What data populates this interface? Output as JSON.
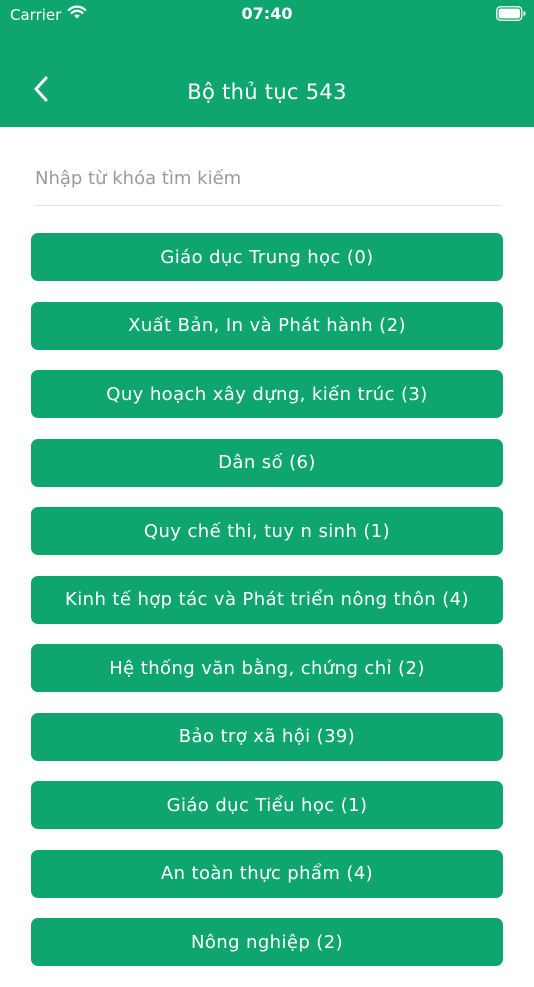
{
  "status_bar": {
    "carrier": "Carrier",
    "time": "07:40"
  },
  "nav": {
    "title": "Bộ thủ tục 543"
  },
  "search": {
    "value": "",
    "placeholder": "Nhập từ khóa tìm kiếm"
  },
  "categories": [
    {
      "label": "Giáo dục Trung học (0)"
    },
    {
      "label": "Xuất Bản, In và Phát hành (2)"
    },
    {
      "label": "Quy hoạch xây dựng, kiến trúc (3)"
    },
    {
      "label": "Dân số (6)"
    },
    {
      "label": "Quy chế thi, tuy n sinh (1)"
    },
    {
      "label": "Kinh tế hợp tác và Phát triển nông thôn (4)"
    },
    {
      "label": "Hệ thống văn bằng, chứng chỉ (2)"
    },
    {
      "label": "Bảo trợ xã hội (39)"
    },
    {
      "label": "Giáo dục Tiểu học (1)"
    },
    {
      "label": "An toàn thực phẩm (4)"
    },
    {
      "label": "Nông nghiệp (2)"
    }
  ],
  "colors": {
    "primary": "#0fa56f",
    "text_on_primary": "#ffffff",
    "placeholder": "#9a9a9a",
    "divider": "#e2e2e2"
  },
  "icons": {
    "wifi": "wifi-icon",
    "battery": "battery-icon",
    "back": "chevron-left-icon"
  }
}
